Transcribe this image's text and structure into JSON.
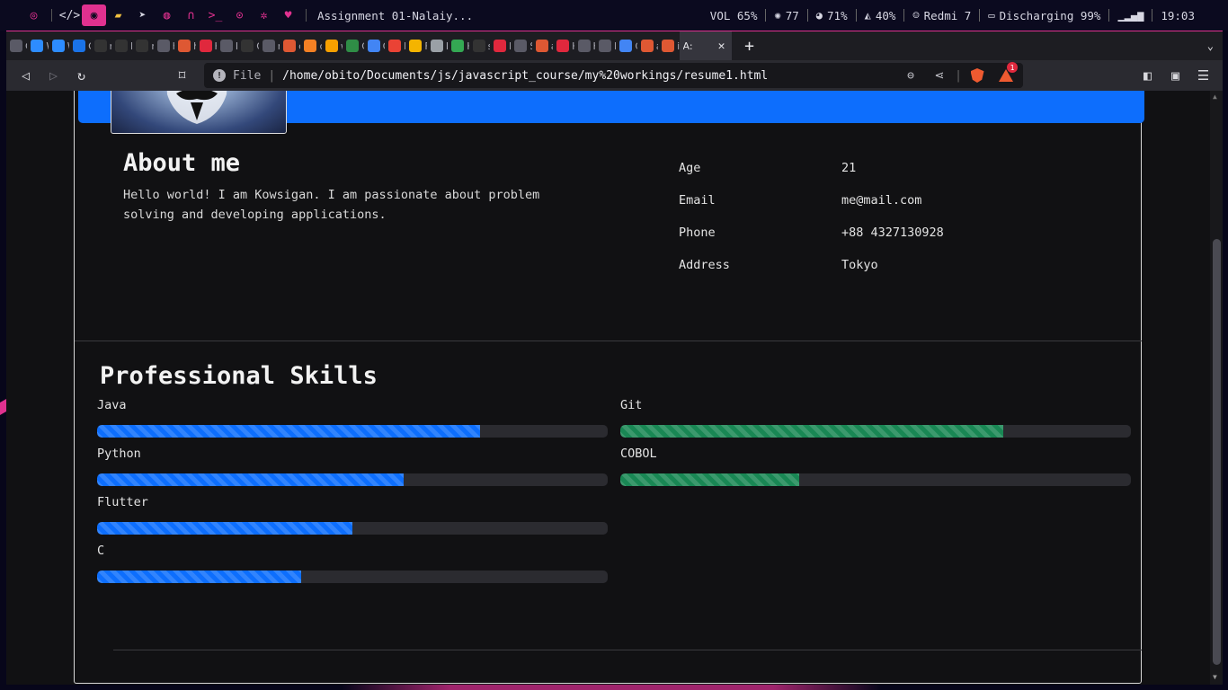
{
  "system_bar": {
    "window_title": "Assignment 01-Nalaiy...",
    "volume": "VOL 65%",
    "cpu": "77",
    "memory": "71%",
    "brightness": "40%",
    "device": "Redmi 7",
    "battery": "Discharging 99%",
    "time": "19:03"
  },
  "browser": {
    "tabs": [
      {
        "icon": "globe-icon",
        "letter": "C",
        "color": "#5a5a66"
      },
      {
        "icon": "zoom-icon",
        "letter": "W",
        "color": "#2d8cff"
      },
      {
        "icon": "zoom-icon",
        "letter": "W",
        "color": "#2d8cff"
      },
      {
        "icon": "calendar-icon",
        "letter": "G",
        "color": "#1a73e8"
      },
      {
        "icon": "github-icon",
        "letter": "n",
        "color": "#333"
      },
      {
        "icon": "github-icon",
        "letter": "D",
        "color": "#333"
      },
      {
        "icon": "github-icon",
        "letter": "n",
        "color": "#333"
      },
      {
        "icon": "globe-icon",
        "letter": "h",
        "color": "#5a5a66"
      },
      {
        "icon": "duckduckgo-icon",
        "letter": "h",
        "color": "#de5833"
      },
      {
        "icon": "pycharm-icon",
        "letter": "H",
        "color": "#e0283d"
      },
      {
        "icon": "globe-icon",
        "letter": "B",
        "color": "#5a5a66"
      },
      {
        "icon": "pencil-icon",
        "letter": "O",
        "color": "#333"
      },
      {
        "icon": "globe-icon",
        "letter": "r",
        "color": "#5a5a66"
      },
      {
        "icon": "duckduckgo-icon",
        "letter": "c",
        "color": "#de5833"
      },
      {
        "icon": "stackoverflow-icon",
        "letter": "c",
        "color": "#f48024"
      },
      {
        "icon": "code-icon",
        "letter": "w",
        "color": "#f7a000"
      },
      {
        "icon": "geeks-icon",
        "letter": "C",
        "color": "#2f8d46"
      },
      {
        "icon": "chrome-icon",
        "letter": "O",
        "color": "#4285f4"
      },
      {
        "icon": "gmail-icon",
        "letter": "R",
        "color": "#ea4335"
      },
      {
        "icon": "slides-icon",
        "letter": "F",
        "color": "#f4b400"
      },
      {
        "icon": "photos-icon",
        "letter": "P",
        "color": "#9aa0a6"
      },
      {
        "icon": "leaf-icon",
        "letter": "H",
        "color": "#34a853"
      },
      {
        "icon": "github-icon",
        "letter": "s",
        "color": "#333"
      },
      {
        "icon": "steps-icon",
        "letter": "F",
        "color": "#e0283d"
      },
      {
        "icon": "gear-icon",
        "letter": "S",
        "color": "#5a5a66"
      },
      {
        "icon": "duckduckgo-icon",
        "letter": "a",
        "color": "#de5833"
      },
      {
        "icon": "vivaldi-icon",
        "letter": "H",
        "color": "#e0283d"
      },
      {
        "icon": "globe-icon",
        "letter": "K",
        "color": "#5a5a66"
      },
      {
        "icon": "globe-icon",
        "letter": "N",
        "color": "#5a5a66"
      },
      {
        "icon": "translate-icon",
        "letter": "G",
        "color": "#4285f4"
      },
      {
        "icon": "duckduckgo-icon",
        "letter": "a",
        "color": "#de5833"
      },
      {
        "icon": "duckduckgo-icon",
        "letter": "i",
        "color": "#de5833"
      }
    ],
    "active_tab_label": "A:",
    "url_scheme": "File",
    "url": "/home/obito/Documents/js/javascript_course/my%20workings/resume1.html",
    "rewards_badge": "1"
  },
  "page": {
    "about": {
      "title": "About me",
      "text": "Hello world! I am Kowsigan. I am passionate about problem solving and developing applications."
    },
    "info": [
      {
        "key": "Age",
        "value": "21"
      },
      {
        "key": "Email",
        "value": "me@mail.com"
      },
      {
        "key": "Phone",
        "value": "+88 4327130928"
      },
      {
        "key": "Address",
        "value": "Tokyo"
      }
    ],
    "skills_title": "Professional Skills",
    "skills_left": [
      {
        "name": "Java",
        "percent": 75
      },
      {
        "name": "Python",
        "percent": 60
      },
      {
        "name": "Flutter",
        "percent": 50
      },
      {
        "name": "C",
        "percent": 40
      }
    ],
    "skills_right": [
      {
        "name": "Git",
        "percent": 75
      },
      {
        "name": "COBOL",
        "percent": 35
      }
    ]
  },
  "colors": {
    "accent_pink": "#e0318f",
    "primary_blue": "#0d6efd",
    "success_green": "#198754"
  }
}
